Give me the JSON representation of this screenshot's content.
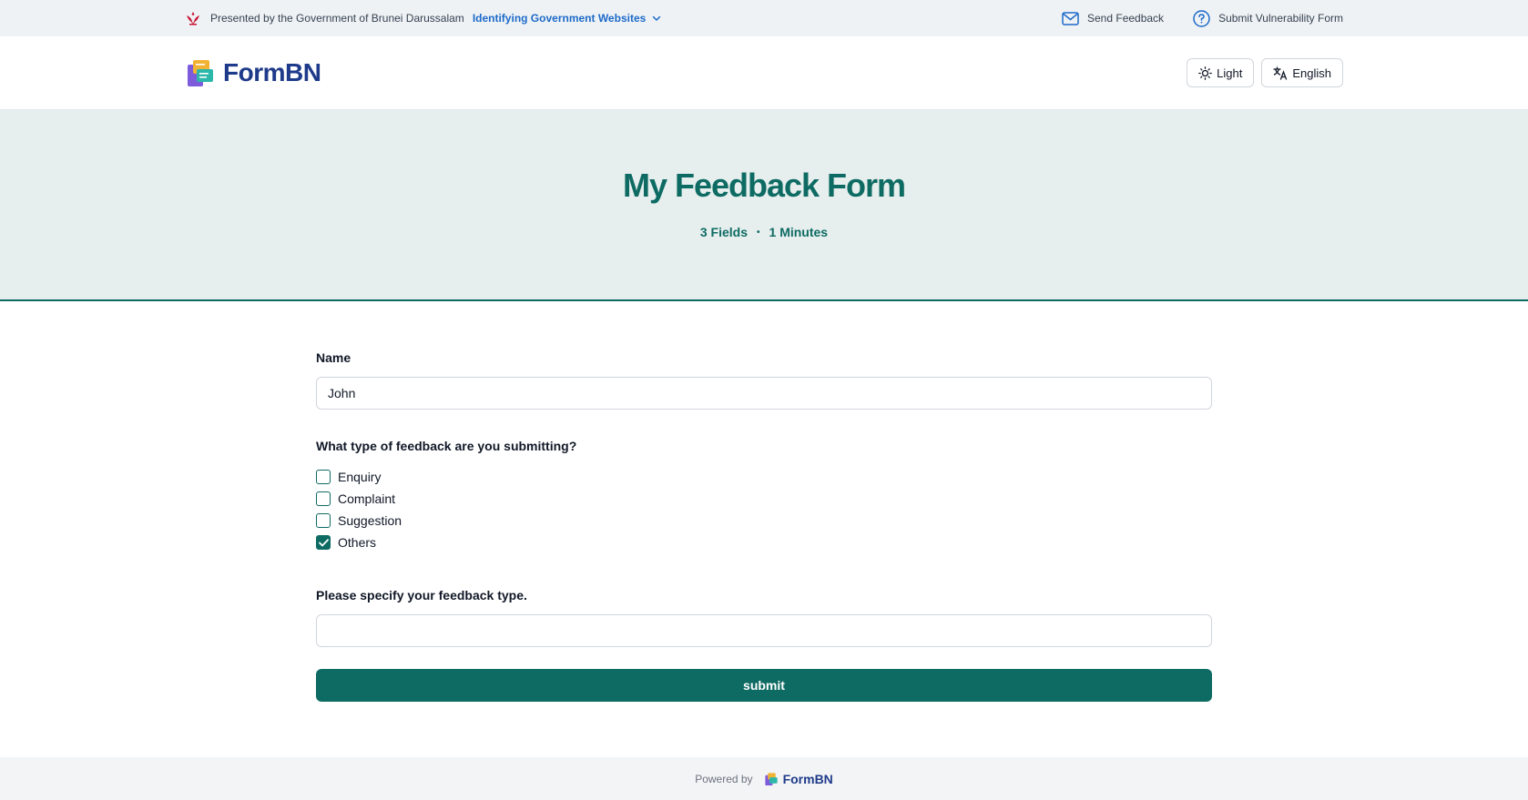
{
  "topbar": {
    "crest_icon": "brunei-crest-icon",
    "presented_text": "Presented by the Government of Brunei Darussalam",
    "identify_link": "Identifying Government Websites",
    "send_feedback": "Send Feedback",
    "submit_vulnerability": "Submit Vulnerability Form"
  },
  "header": {
    "brand_name": "FormBN",
    "theme_label": "Light",
    "language_label": "English"
  },
  "hero": {
    "title": "My Feedback Form",
    "fields": "3 Fields",
    "separator": "•",
    "duration": "1 Minutes"
  },
  "form": {
    "name_label": "Name",
    "name_value": "John",
    "type_question": "What type of feedback are you submitting?",
    "options": [
      {
        "label": "Enquiry",
        "checked": false
      },
      {
        "label": "Complaint",
        "checked": false
      },
      {
        "label": "Suggestion",
        "checked": false
      },
      {
        "label": "Others",
        "checked": true
      }
    ],
    "specify_label": "Please specify your feedback type.",
    "specify_value": "",
    "submit_label": "submit"
  },
  "footer": {
    "powered_by": "Powered by",
    "brand_name": "FormBN"
  },
  "colors": {
    "primary": "#0e6b63",
    "link": "#1d6ac9",
    "brand": "#1e3a8a",
    "hero_bg": "#e6efee"
  }
}
